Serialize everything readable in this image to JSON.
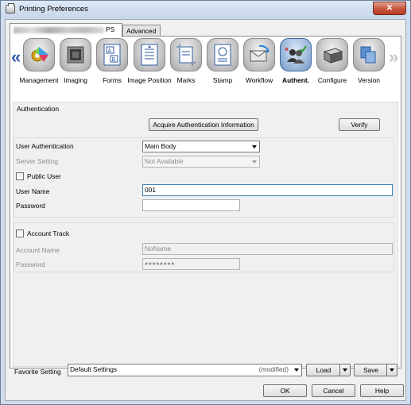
{
  "window": {
    "title": "Printing Preferences",
    "close_symbol": "✕"
  },
  "tabs": {
    "main_tab_suffix": "PS",
    "advanced": "Advanced"
  },
  "nav": {
    "left_arrow": "«",
    "right_arrow": "»"
  },
  "icons": [
    {
      "label": "Management",
      "icon": "management-icon"
    },
    {
      "label": "Imaging",
      "icon": "imaging-icon"
    },
    {
      "label": "Forms",
      "icon": "forms-icon"
    },
    {
      "label": "Image Position",
      "icon": "image-position-icon"
    },
    {
      "label": "Marks",
      "icon": "marks-icon"
    },
    {
      "label": "Stamp",
      "icon": "stamp-icon"
    },
    {
      "label": "Workflow",
      "icon": "workflow-icon"
    },
    {
      "label": "Authent.",
      "icon": "authentication-icon",
      "selected": true
    },
    {
      "label": "Configure",
      "icon": "configure-icon"
    },
    {
      "label": "Version",
      "icon": "version-icon"
    }
  ],
  "auth": {
    "section_title": "Authentication",
    "acquire_button": "Acquire Authentication Information",
    "verify_button": "Verify",
    "user_auth_label": "User Authentication",
    "user_auth_value": "Main Body",
    "server_setting_label": "Server Setting",
    "server_setting_value": "Not Available",
    "public_user_label": "Public User",
    "public_user_checked": false,
    "user_name_label": "User Name",
    "user_name_value": "001",
    "password_label": "Password",
    "password_value": ""
  },
  "account": {
    "account_track_label": "Account Track",
    "account_track_checked": false,
    "account_name_label": "Account Name",
    "account_name_value": "NoName",
    "password_label": "Password",
    "password_value": "●●●●●●●●"
  },
  "favorite": {
    "label": "Favorite Setting",
    "value": "Default Settings",
    "modified": "(modified)",
    "load_button": "Load",
    "save_button": "Save"
  },
  "footer": {
    "ok": "OK",
    "cancel": "Cancel",
    "help": "Help"
  },
  "colors": {
    "accent_selected": "#6f92c0",
    "window_frame": "#cfdcec",
    "close_button": "#c85a42"
  }
}
